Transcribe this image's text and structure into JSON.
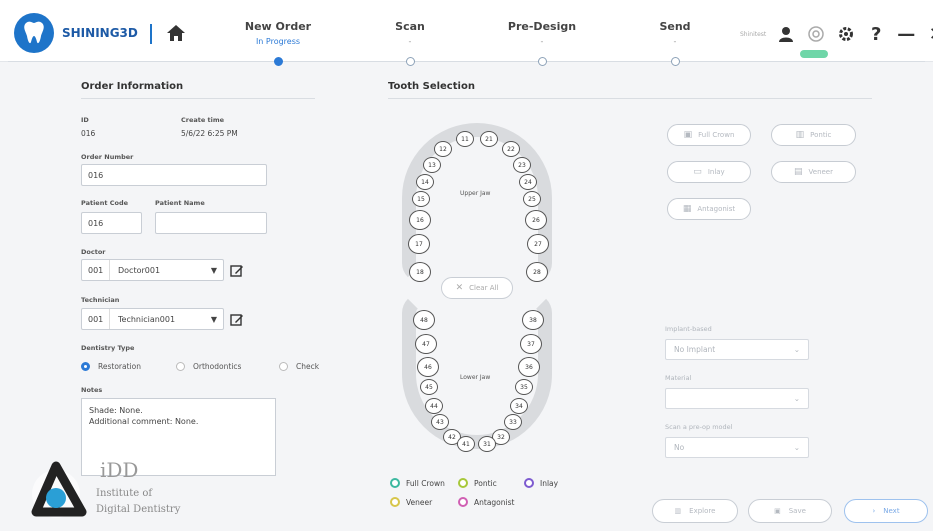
{
  "app": {
    "brand": "SHINING3D"
  },
  "steps": [
    {
      "title": "New Order",
      "status": "In Progress"
    },
    {
      "title": "Scan",
      "status": "-"
    },
    {
      "title": "Pre-Design",
      "status": "-"
    },
    {
      "title": "Send",
      "status": "-"
    }
  ],
  "header": {
    "user": "Shinitest"
  },
  "order": {
    "section_title": "Order Information",
    "id_label": "ID",
    "id_value": "016",
    "create_label": "Create time",
    "create_value": "5/6/22 6:25 PM",
    "order_number_label": "Order Number",
    "order_number_value": "016",
    "patient_code_label": "Patient Code",
    "patient_code_value": "016",
    "patient_name_label": "Patient Name",
    "patient_name_value": "",
    "doctor_label": "Doctor",
    "doctor_code": "001",
    "doctor_name": "Doctor001",
    "technician_label": "Technician",
    "technician_code": "001",
    "technician_name": "Technician001",
    "dentistry_label": "Dentistry Type",
    "dentistry_options": [
      "Restoration",
      "Orthodontics",
      "Check"
    ],
    "dentistry_selected": "Restoration",
    "notes_label": "Notes",
    "notes_lines": [
      "Shade: None.",
      "Additional comment: None."
    ]
  },
  "tooth_selection": {
    "section_title": "Tooth Selection",
    "upper_jaw_label": "Upper Jaw",
    "lower_jaw_label": "Lower Jaw",
    "clear_all": "Clear All",
    "upper_teeth": [
      "11",
      "21",
      "12",
      "22",
      "13",
      "23",
      "14",
      "24",
      "15",
      "25",
      "16",
      "26",
      "17",
      "27",
      "18",
      "28"
    ],
    "lower_teeth": [
      "48",
      "38",
      "47",
      "37",
      "46",
      "36",
      "45",
      "35",
      "44",
      "34",
      "43",
      "33",
      "42",
      "32",
      "41",
      "31"
    ],
    "type_buttons": [
      "Full Crown",
      "Pontic",
      "Inlay",
      "Veneer",
      "Antagonist"
    ],
    "legend": [
      {
        "label": "Full Crown",
        "color": "#3cb8a0"
      },
      {
        "label": "Pontic",
        "color": "#a7c83a"
      },
      {
        "label": "Inlay",
        "color": "#7d5bd0"
      },
      {
        "label": "Veneer",
        "color": "#d7c64a"
      },
      {
        "label": "Antagonist",
        "color": "#d05fb3"
      }
    ]
  },
  "options": {
    "implant_label": "Implant-based",
    "implant_value": "No Implant",
    "material_label": "Material",
    "material_value": "",
    "prescan_label": "Scan a pre-op model",
    "prescan_value": "No"
  },
  "footer": {
    "explore": "Explore",
    "save": "Save",
    "next": "Next"
  },
  "watermark": {
    "line1": "iDD",
    "line2": "Institute of",
    "line3": "Digital Dentistry"
  },
  "colors": {
    "accent": "#2c7ad6",
    "brand": "#1d5aa6"
  }
}
